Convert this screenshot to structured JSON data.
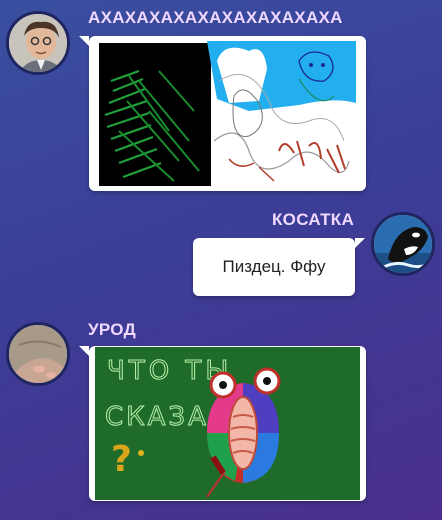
{
  "messages": [
    {
      "author": "АХАХАХАХАХАХАХАХАХАХА",
      "avatar_icon": "man-portrait-icon",
      "type": "drawing"
    },
    {
      "author": "КОСАТКА",
      "avatar_icon": "orca-icon",
      "type": "text",
      "text": "Пиздец. Ффу"
    },
    {
      "author": "УРОД",
      "avatar_icon": "hand-photo-icon",
      "type": "drawing",
      "drawing_text": [
        "ЧТО ТЫ",
        "СКАЗАЛ",
        "?"
      ]
    }
  ],
  "colors": {
    "name": "#f0d8ff",
    "board_green": "#1e6b2a",
    "bubble": "#ffffff"
  }
}
